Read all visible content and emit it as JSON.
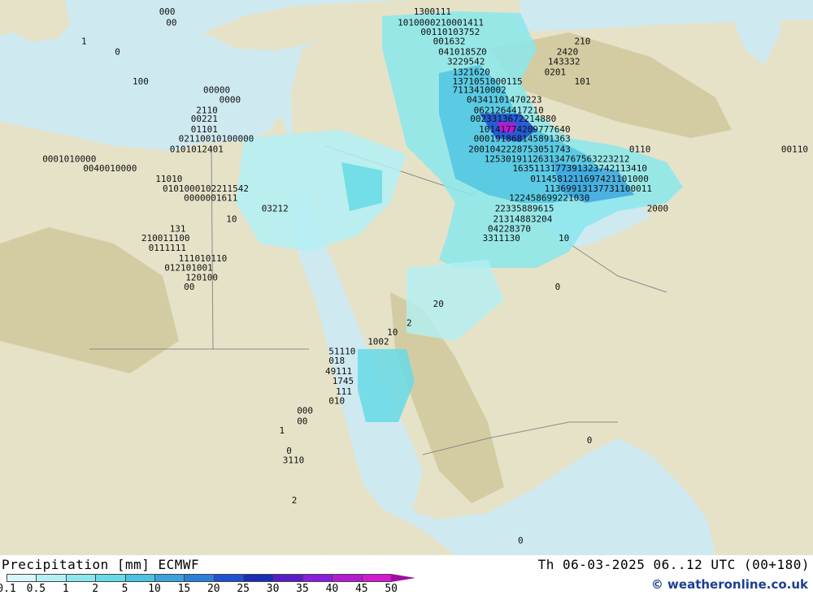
{
  "legend": {
    "title": "Precipitation [mm] ECMWF",
    "levels": [
      "0.1",
      "0.5",
      "1",
      "2",
      "5",
      "10",
      "15",
      "20",
      "25",
      "30",
      "35",
      "40",
      "45",
      "50"
    ],
    "colors": [
      "#d9f7fa",
      "#b3f0f4",
      "#8ae8ec",
      "#66dbe6",
      "#4cc3e2",
      "#3aa3df",
      "#2c7fdc",
      "#2050d3",
      "#1a2cb8",
      "#5b1acb",
      "#8c1ddf",
      "#b51ad4",
      "#d41ad0",
      "#9b119e"
    ]
  },
  "valid_time": "Th 06-03-2025 06..12 UTC (00+180)",
  "credit": "© weatheronline.co.uk",
  "map": {
    "sea_color": "#cfe9f1",
    "land_color": "#e6e2c8",
    "highland_color": "#d3cca2",
    "border_color": "#8a8a8a",
    "point_values": [
      {
        "lat": 40.6,
        "lon": 41.4,
        "value": "1300111"
      },
      {
        "lat": 39.6,
        "lon": 40.5,
        "value": "1010000210001411"
      },
      {
        "lat": 38.7,
        "lon": 41.8,
        "value": "00110103752"
      },
      {
        "lat": 37.8,
        "lon": 42.5,
        "value": "001632"
      },
      {
        "lat": 36.8,
        "lon": 42.8,
        "value": "0410185Z0"
      },
      {
        "lat": 35.9,
        "lon": 43.3,
        "value": "3229542"
      },
      {
        "lat": 34.9,
        "lon": 43.6,
        "value": "1321620"
      },
      {
        "lat": 34.0,
        "lon": 43.6,
        "value": "1371051000115"
      },
      {
        "lat": 33.2,
        "lon": 43.6,
        "value": "7113410002"
      },
      {
        "lat": 32.3,
        "lon": 44.4,
        "value": "04341101470223"
      },
      {
        "lat": 31.3,
        "lon": 44.8,
        "value": "0621264417210"
      },
      {
        "lat": 30.5,
        "lon": 44.6,
        "value": "0023313672214880"
      },
      {
        "lat": 29.5,
        "lon": 45.1,
        "value": "10141774209777640"
      },
      {
        "lat": 28.6,
        "lon": 44.8,
        "value": "000191868145891363"
      },
      {
        "lat": 27.6,
        "lon": 44.5,
        "value": "2001042228753051743"
      },
      {
        "lat": 26.7,
        "lon": 45.4,
        "value": "125301911263134767563223212"
      },
      {
        "lat": 25.8,
        "lon": 47.0,
        "value": "1635113177391323742113410"
      },
      {
        "lat": 24.8,
        "lon": 48.0,
        "value": "0114581211697421101000"
      },
      {
        "lat": 23.9,
        "lon": 48.8,
        "value": "11369913137731100011"
      },
      {
        "lat": 23.0,
        "lon": 46.8,
        "value": "122458699221030"
      },
      {
        "lat": 22.0,
        "lon": 46.0,
        "value": "22335889615"
      },
      {
        "lat": 21.0,
        "lon": 45.9,
        "value": "21314883204"
      },
      {
        "lat": 20.1,
        "lon": 45.6,
        "value": "04228370"
      },
      {
        "lat": 19.2,
        "lon": 45.3,
        "value": "3311130"
      },
      {
        "lat": 40.6,
        "lon": 27.0,
        "value": "000"
      },
      {
        "lat": 39.6,
        "lon": 27.4,
        "value": "00"
      },
      {
        "lat": 37.8,
        "lon": 22.6,
        "value": "1"
      },
      {
        "lat": 36.8,
        "lon": 24.5,
        "value": "0"
      },
      {
        "lat": 34.0,
        "lon": 25.5,
        "value": "100"
      },
      {
        "lat": 33.2,
        "lon": 29.5,
        "value": "00000"
      },
      {
        "lat": 32.3,
        "lon": 30.4,
        "value": "0000"
      },
      {
        "lat": 31.3,
        "lon": 29.1,
        "value": "2110"
      },
      {
        "lat": 30.5,
        "lon": 28.8,
        "value": "00221"
      },
      {
        "lat": 29.5,
        "lon": 28.8,
        "value": "01101"
      },
      {
        "lat": 28.6,
        "lon": 28.1,
        "value": "02110010100000"
      },
      {
        "lat": 27.6,
        "lon": 27.6,
        "value": "0101012401"
      },
      {
        "lat": 26.7,
        "lon": 20.4,
        "value": "0001010000"
      },
      {
        "lat": 25.8,
        "lon": 22.7,
        "value": "0040010000"
      },
      {
        "lat": 24.8,
        "lon": 26.8,
        "value": "11010"
      },
      {
        "lat": 23.9,
        "lon": 27.2,
        "value": "0101000102211542"
      },
      {
        "lat": 23.0,
        "lon": 28.4,
        "value": "0000001611"
      },
      {
        "lat": 22.0,
        "lon": 32.8,
        "value": "03212"
      },
      {
        "lat": 21.0,
        "lon": 30.8,
        "value": "10"
      },
      {
        "lat": 20.1,
        "lon": 27.6,
        "value": "131"
      },
      {
        "lat": 19.2,
        "lon": 26.0,
        "value": "210011100"
      },
      {
        "lat": 18.3,
        "lon": 26.4,
        "value": "0111111"
      },
      {
        "lat": 17.3,
        "lon": 28.1,
        "value": "111010110"
      },
      {
        "lat": 16.4,
        "lon": 27.3,
        "value": "012101001"
      },
      {
        "lat": 15.5,
        "lon": 28.5,
        "value": "120100"
      },
      {
        "lat": 14.6,
        "lon": 28.4,
        "value": "00"
      },
      {
        "lat": 13.0,
        "lon": 42.5,
        "value": "20"
      },
      {
        "lat": 11.2,
        "lon": 41.0,
        "value": "2"
      },
      {
        "lat": 10.3,
        "lon": 39.9,
        "value": "10"
      },
      {
        "lat": 9.4,
        "lon": 38.8,
        "value": "1002"
      },
      {
        "lat": 8.5,
        "lon": 36.6,
        "value": "51110"
      },
      {
        "lat": 7.6,
        "lon": 36.6,
        "value": "018"
      },
      {
        "lat": 6.6,
        "lon": 36.4,
        "value": "49111"
      },
      {
        "lat": 5.7,
        "lon": 36.8,
        "value": "1745"
      },
      {
        "lat": 4.7,
        "lon": 37.0,
        "value": "111"
      },
      {
        "lat": 3.8,
        "lon": 36.6,
        "value": "010"
      },
      {
        "lat": 2.9,
        "lon": 34.8,
        "value": "000"
      },
      {
        "lat": 1.9,
        "lon": 34.8,
        "value": "00"
      },
      {
        "lat": 1.0,
        "lon": 33.8,
        "value": "1"
      },
      {
        "lat": -0.9,
        "lon": 34.2,
        "value": "0"
      },
      {
        "lat": -1.8,
        "lon": 34.0,
        "value": "3110"
      },
      {
        "lat": -5.6,
        "lon": 34.5,
        "value": "2"
      },
      {
        "lat": 36.8,
        "lon": 49.5,
        "value": "2420"
      },
      {
        "lat": 35.9,
        "lon": 49.0,
        "value": "143332"
      },
      {
        "lat": 34.9,
        "lon": 48.8,
        "value": "0201"
      },
      {
        "lat": 34.0,
        "lon": 50.5,
        "value": "101"
      },
      {
        "lat": 37.8,
        "lon": 50.5,
        "value": "210"
      },
      {
        "lat": 27.6,
        "lon": 53.6,
        "value": "0110"
      },
      {
        "lat": 27.6,
        "lon": 62.2,
        "value": "00110"
      },
      {
        "lat": 22.0,
        "lon": 54.6,
        "value": "2000"
      },
      {
        "lat": 19.2,
        "lon": 49.6,
        "value": "10"
      },
      {
        "lat": 14.6,
        "lon": 49.4,
        "value": "0"
      },
      {
        "lat": 0.1,
        "lon": 51.2,
        "value": "0"
      },
      {
        "lat": -9.4,
        "lon": 47.3,
        "value": "0"
      }
    ]
  }
}
